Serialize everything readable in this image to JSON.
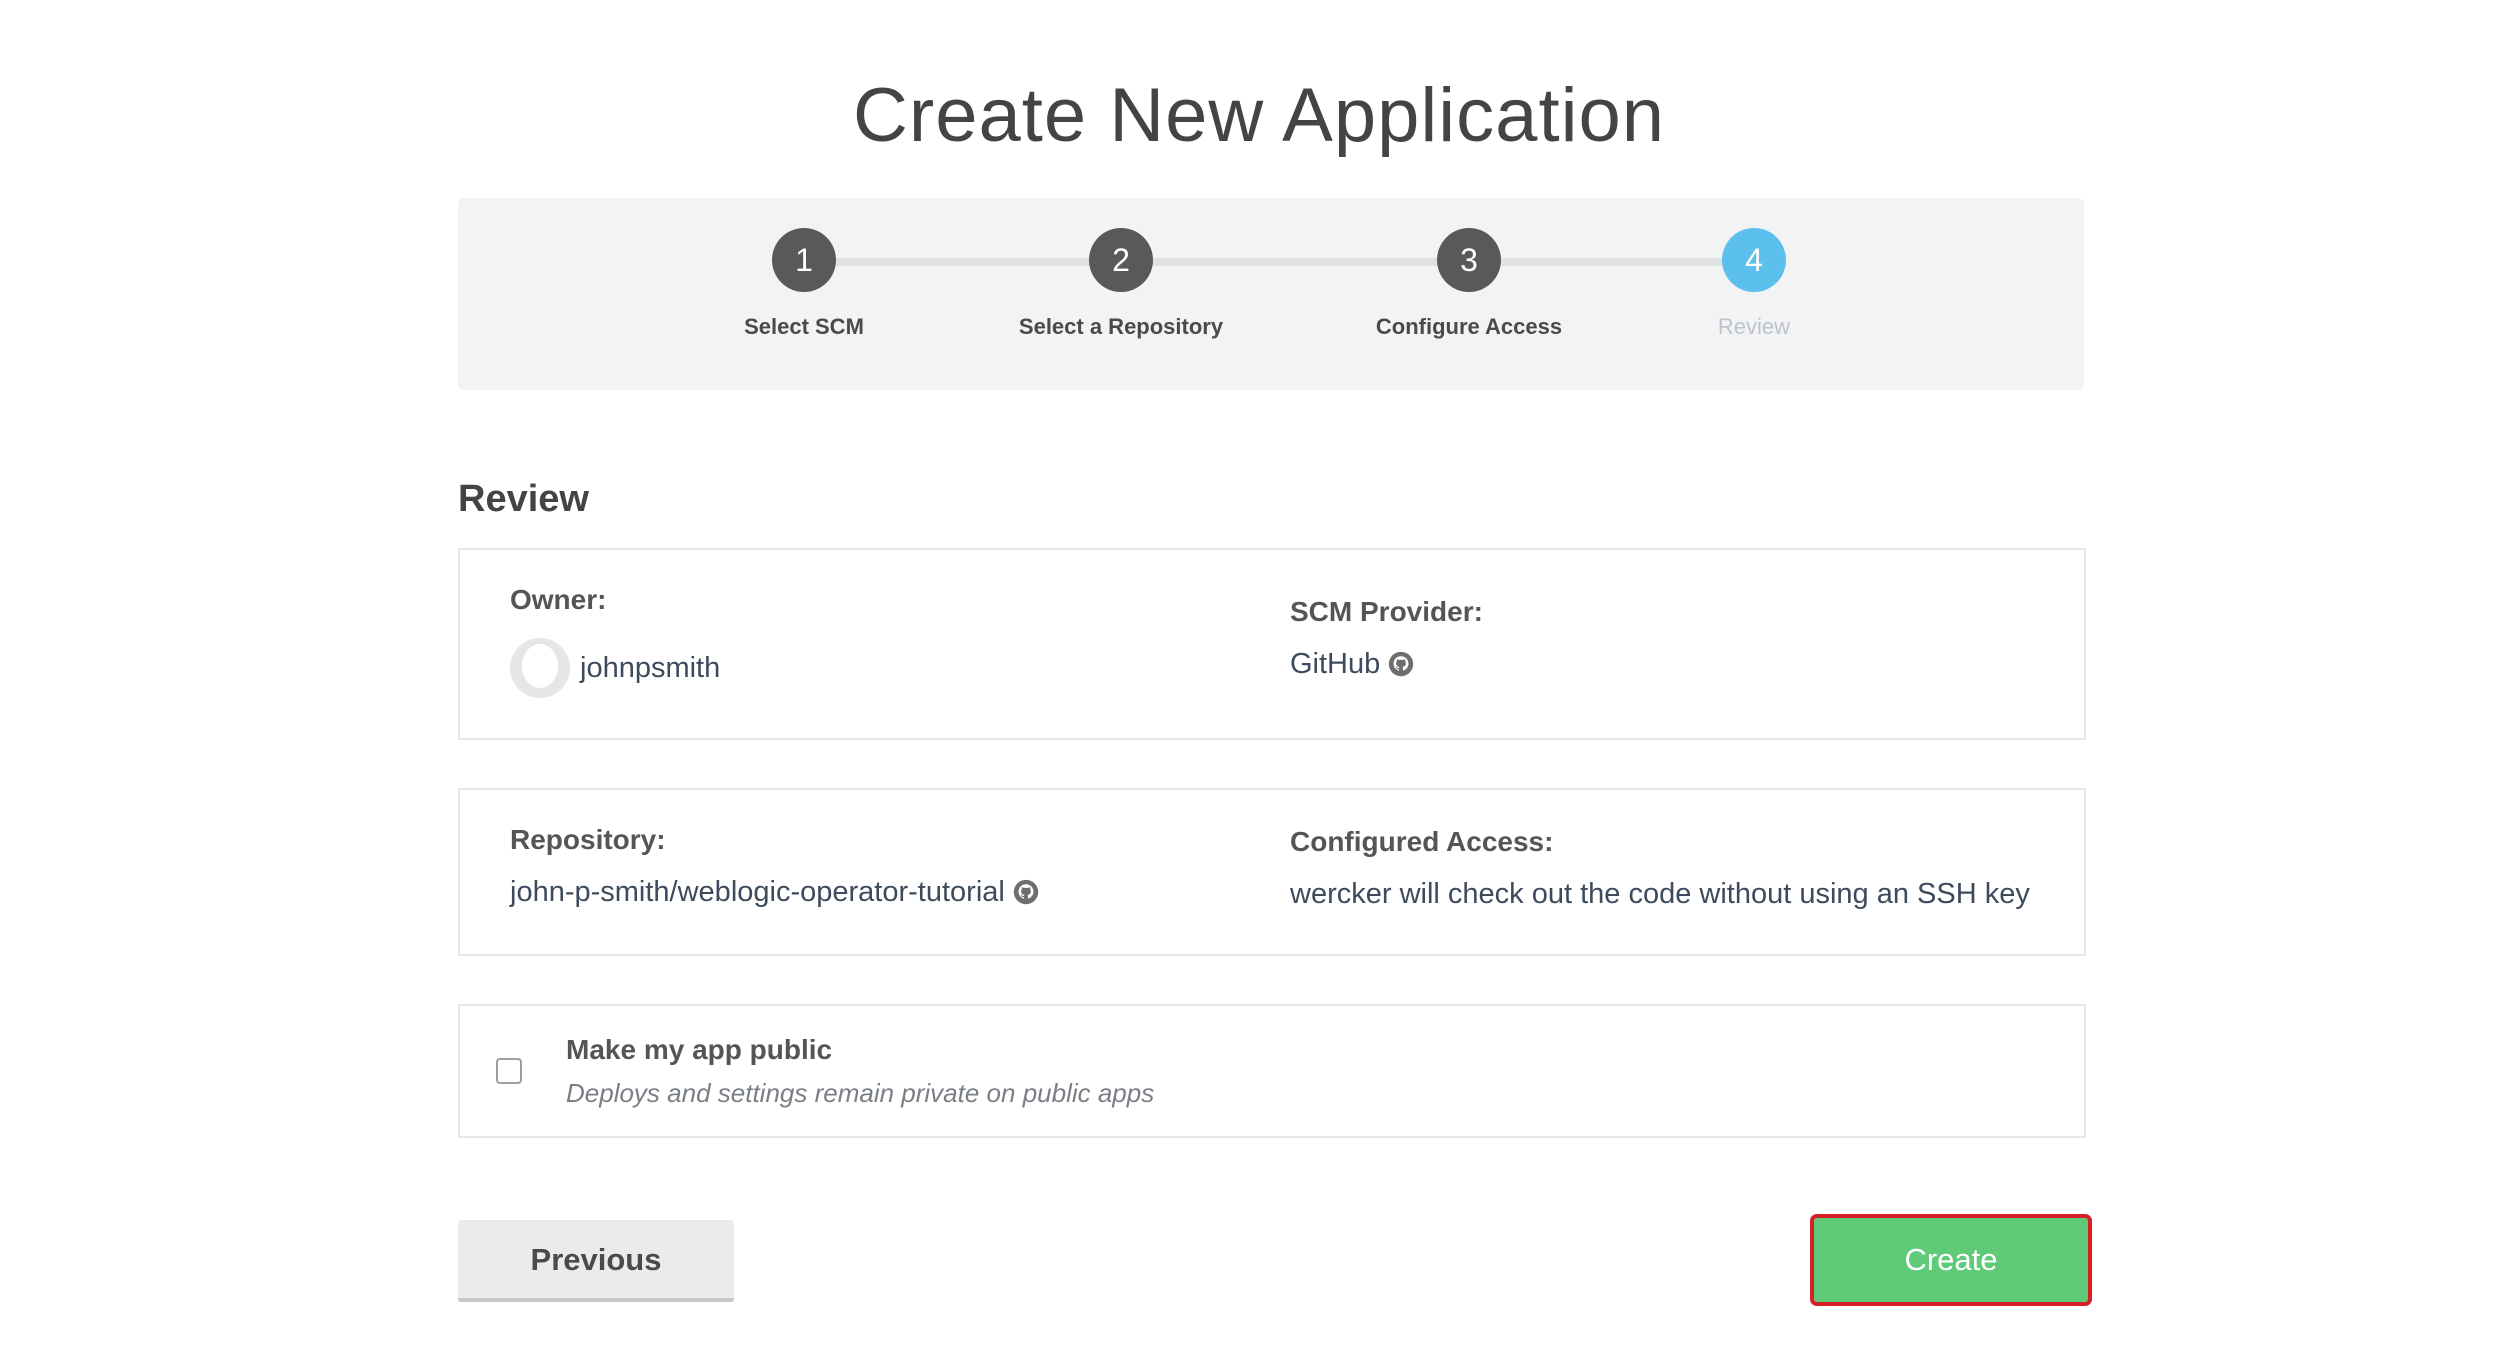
{
  "page_title": "Create New Application",
  "stepper": {
    "steps": [
      {
        "number": "1",
        "label": "Select SCM"
      },
      {
        "number": "2",
        "label": "Select a Repository"
      },
      {
        "number": "3",
        "label": "Configure Access"
      },
      {
        "number": "4",
        "label": "Review"
      }
    ],
    "active_step": 4
  },
  "review": {
    "title": "Review",
    "owner_label": "Owner:",
    "owner_value": "johnpsmith",
    "scm_label": "SCM Provider:",
    "scm_value": "GitHub",
    "repo_label": "Repository:",
    "repo_value": "john-p-smith/weblogic-operator-tutorial",
    "access_label": "Configured Access:",
    "access_value": "wercker will check out the code without using an SSH key"
  },
  "public_option": {
    "title": "Make my app public",
    "subtitle": "Deploys and settings remain private on public apps",
    "checked": false
  },
  "buttons": {
    "previous": "Previous",
    "create": "Create"
  },
  "colors": {
    "step_done": "#595959",
    "step_active": "#5bc0eb",
    "create_button": "#5fcb78",
    "highlight_border": "#d61f26"
  },
  "icons": {
    "github": "github-icon",
    "avatar": "avatar-placeholder"
  }
}
